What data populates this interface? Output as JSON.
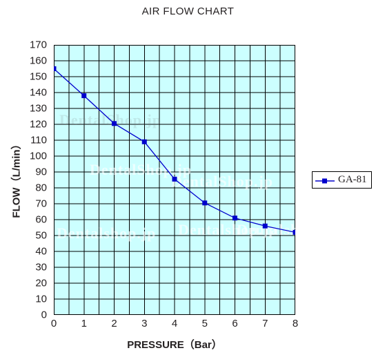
{
  "chart_data": {
    "type": "line",
    "title": "AIR FLOW CHART",
    "xlabel": "PRESSURE（Bar）",
    "ylabel": "FLOW（L/min）",
    "x": [
      0,
      1,
      2,
      3,
      4,
      5,
      6,
      7,
      8
    ],
    "xlim": [
      0,
      8
    ],
    "ylim": [
      0,
      170
    ],
    "x_ticks": [
      "0",
      "1",
      "2",
      "3",
      "4",
      "5",
      "6",
      "7",
      "8"
    ],
    "y_ticks": [
      "170",
      "160",
      "150",
      "140",
      "130",
      "120",
      "110",
      "100",
      "90",
      "80",
      "70",
      "60",
      "50",
      "40",
      "30",
      "20",
      "10",
      "0"
    ],
    "x_major_step": 1,
    "x_minor_step": 0.5,
    "y_major_step": 10,
    "grid": true,
    "legend_position": "right",
    "series": [
      {
        "name": "GA-81",
        "color": "#0000cc",
        "marker": "square",
        "values": [
          155,
          138,
          120.5,
          109,
          85.5,
          70.5,
          61,
          56,
          52
        ]
      }
    ],
    "plot_background": "#ccffff",
    "axis_color": "#000000"
  },
  "legend": {
    "entries": [
      {
        "label": "GA-81"
      }
    ]
  },
  "watermarks": [
    {
      "text": "DentalShop.jp"
    },
    {
      "text": "DentalShop.jp"
    },
    {
      "text": "DentalShop.jp"
    },
    {
      "text": "Dentalshop.jp"
    },
    {
      "text": "Dentalshop.jp"
    },
    {
      "text": "Dentalshop.jp"
    }
  ]
}
